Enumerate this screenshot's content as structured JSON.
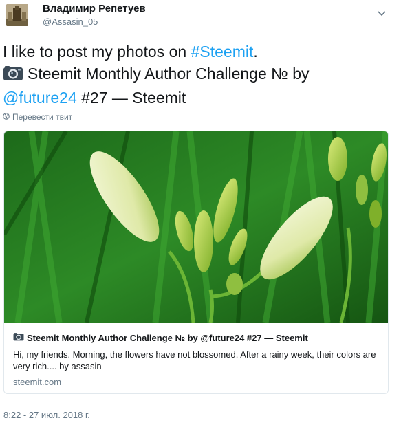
{
  "user": {
    "name": "Владимир Репетуев",
    "handle": "@Assasin_05"
  },
  "tweet": {
    "line1_text": "I like to post my photos on ",
    "line1_hashtag": "#Steemit",
    "line1_end": ".",
    "line2_text": "Steemit Monthly Author Challenge № by",
    "line3_mention": "@future24",
    "line3_text": " #27 — Steemit"
  },
  "translate_label": "Перевести твит",
  "card": {
    "title": "Steemit Monthly Author Challenge № by @future24 #27 — Steemit",
    "description": "Hi, my friends. Morning, the flowers have not blossomed. After a rainy week, their colors are very rich.... by assasin",
    "domain": "steemit.com"
  },
  "timestamp": "8:22 - 27 июл. 2018 г.",
  "icons": [
    "avatar",
    "chevron-down-icon",
    "camera-icon",
    "globe-icon"
  ],
  "colors": {
    "link": "#1da1f2",
    "secondary": "#657786",
    "border": "#e1e8ed"
  }
}
